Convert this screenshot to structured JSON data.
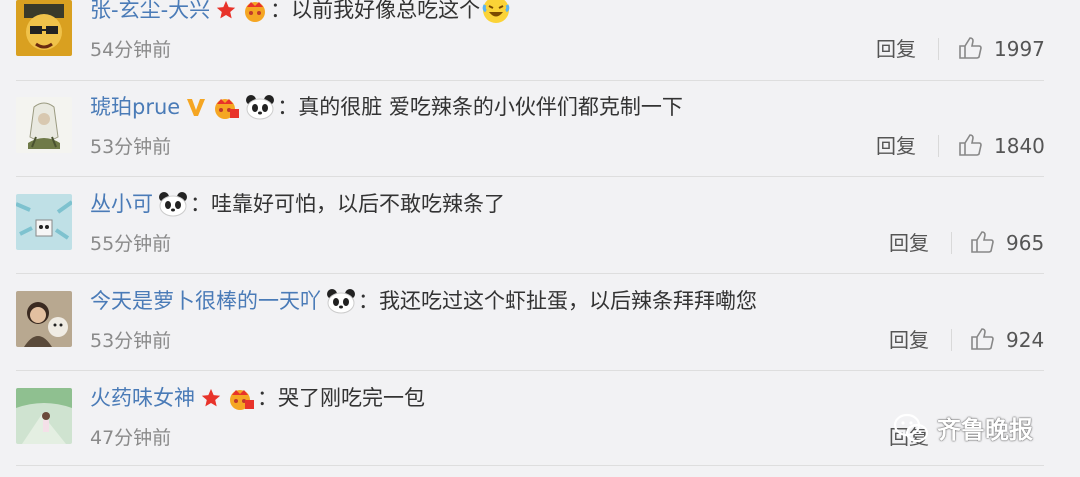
{
  "comments": [
    {
      "username": "张-玄尘-大兴",
      "text": "以前我好像总吃这个",
      "time": "54分钟前",
      "reply_label": "回复",
      "likes": "1997",
      "badges": [
        "star-icon",
        "crown-icon"
      ],
      "trailing_emoji": "laughing-emoji-icon"
    },
    {
      "username": "琥珀prue",
      "text": "真的很脏 爱吃辣条的小伙伴们都克制一下",
      "time": "53分钟前",
      "reply_label": "回复",
      "likes": "1840",
      "badges": [
        "verified-v-icon",
        "crown-icon",
        "panda-icon"
      ]
    },
    {
      "username": "丛小可",
      "text": "哇靠好可怕，以后不敢吃辣条了",
      "time": "55分钟前",
      "reply_label": "回复",
      "likes": "965",
      "badges": [
        "panda-icon"
      ]
    },
    {
      "username": "今天是萝卜很棒的一天吖",
      "text": "我还吃过这个虾扯蛋，以后辣条拜拜嘞您",
      "time": "53分钟前",
      "reply_label": "回复",
      "likes": "924",
      "badges": [
        "panda-icon"
      ]
    },
    {
      "username": "火药味女神",
      "text": "哭了刚吃完一包",
      "time": "47分钟前",
      "reply_label": "回复",
      "likes": "",
      "badges": [
        "star-icon",
        "crown-icon"
      ]
    }
  ],
  "watermark": "齐鲁晚报",
  "colors": {
    "username": "#4a7bb7",
    "text": "#333333",
    "meta": "#8a8a8a",
    "background": "#f2f2f4",
    "star": "#e8332a",
    "crown": "#f5a623"
  }
}
